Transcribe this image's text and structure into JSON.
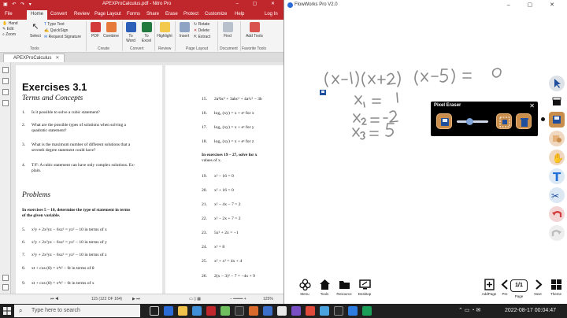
{
  "nitro": {
    "title": "APEXProCalculus.pdf - Nitro Pro",
    "menu": [
      "File",
      "Home",
      "Convert",
      "Review",
      "Page Layout",
      "Forms",
      "Share",
      "Erase",
      "Protect",
      "Customize",
      "Help",
      "Log In"
    ],
    "ribbon": {
      "mode_items": [
        "Hand",
        "Edit",
        "Zoom"
      ],
      "select": "Select",
      "tools_items": [
        "Type Text",
        "QuickSign",
        "Request Signature"
      ],
      "pdf": "PDF",
      "combine": "Combine",
      "to_word": "To Word",
      "to_excel": "To Excel",
      "highlight": "Highlight",
      "insert": "Insert",
      "page_items": [
        "Rotate",
        "Delete",
        "Extract"
      ],
      "find": "Find",
      "add_tools": "Add Tools",
      "groups": [
        "Tools",
        "Create",
        "Convert",
        "Review",
        "Page Layout",
        "Document",
        "Favorite Tools"
      ]
    },
    "doc_tab": "APEXProCalculus",
    "page1": {
      "title": "Exercises 3.1",
      "subtitle": "Terms and Concepts",
      "items": [
        {
          "n": "1.",
          "lines": [
            "Is it possible to solve a cubic statement?"
          ]
        },
        {
          "n": "2.",
          "lines": [
            "What are the possible types of solutions when solving a",
            "quadratic statement?"
          ]
        },
        {
          "n": "3.",
          "lines": [
            "What is the maximum number of different solutions that a",
            "seventh degree statement could have?"
          ]
        },
        {
          "n": "4.",
          "lines": [
            "T/F: A cubic statement can have only complex solutions. Ex-",
            "plain."
          ]
        }
      ],
      "problems_heading": "Problems",
      "instruction": [
        "In exercises 5 – 10, determine the type of statement in terms",
        "of the given variable."
      ],
      "problems": [
        {
          "n": "5.",
          "eq": "x²y + 2x²yz − 6xz² = yz² − 10 in terms of x"
        },
        {
          "n": "6.",
          "eq": "x²y + 2x²yz − 6xz² = yz² − 10 in terms of y"
        },
        {
          "n": "7.",
          "eq": "x²y + 2x²yz − 6xz² = yz² − 10 in terms of z"
        },
        {
          "n": "8.",
          "eq": "xt + cos (θ) = x⁴t² − 6t in terms of θ"
        },
        {
          "n": "9.",
          "eq": "xt + cos (θ) = x⁴t² − 6t in terms of x"
        }
      ]
    },
    "page2": {
      "items": [
        {
          "n": "15.",
          "eq": "2a³bc³ + 3abc² + 4a²c² − 3b"
        },
        {
          "n": "16.",
          "eq": "log₂ (xy) = x + eᶻ for x"
        },
        {
          "n": "17.",
          "eq": "log₂ (xy) = x + eᶻ for y"
        },
        {
          "n": "18.",
          "eq": "log₂ (xy) = x + eᶻ for z"
        }
      ],
      "instruction": [
        "In exercises 19 – 27, solve for x",
        "values of x."
      ],
      "problems": [
        {
          "n": "19.",
          "eq": "x² − 16 = 0"
        },
        {
          "n": "20.",
          "eq": "x² + 16 = 0"
        },
        {
          "n": "21.",
          "eq": "x² − 4x − 7 = 2"
        },
        {
          "n": "22.",
          "eq": "x² − 2x + 7 = 2"
        },
        {
          "n": "23.",
          "eq": "5x² + 2x = −1"
        },
        {
          "n": "24.",
          "eq": "x² = 8"
        },
        {
          "n": "25.",
          "eq": "x² + x² = 4x + 4"
        },
        {
          "n": "26.",
          "eq": "2(x − 3)² − 7 = −4x + 9"
        }
      ]
    },
    "status": {
      "page": "115 (122 OF 164)",
      "zoom": "125%"
    }
  },
  "flow": {
    "title": "FlowWorks Pro V2.0",
    "eraser_panel": {
      "title": "Pixel Eraser",
      "size_fraction": 0.4
    },
    "bottom": {
      "left": [
        "Menu",
        "Tools",
        "Resource",
        "Desktop"
      ],
      "right": [
        "AddPage",
        "Pre",
        "Page",
        "Next",
        "Theme"
      ],
      "page_indicator": "1/1"
    },
    "colors": {
      "accent": "#c98e4b",
      "active_blue": "#2a6bd6"
    }
  },
  "taskbar": {
    "search_placeholder": "Type here to search",
    "date": "2022-08-17",
    "time": "00:04:47"
  }
}
